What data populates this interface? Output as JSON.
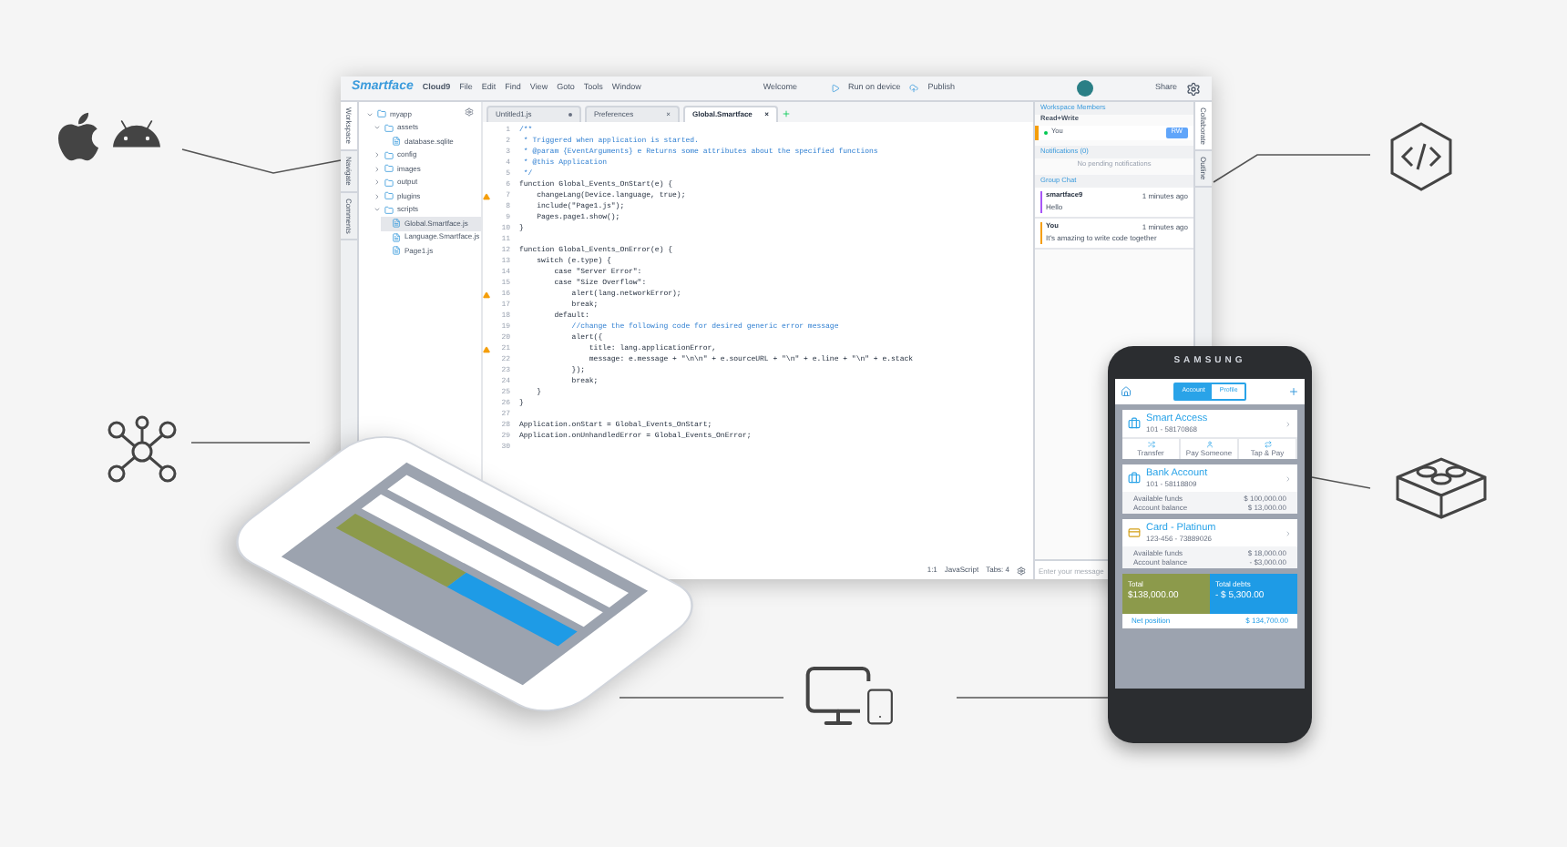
{
  "ide": {
    "menu_bar": {
      "logo": "Smartface",
      "product": "Cloud9",
      "menus": [
        "File",
        "Edit",
        "Find",
        "View",
        "Goto",
        "Tools",
        "Window"
      ],
      "welcome": "Welcome",
      "run": "Run on device",
      "publish": "Publish",
      "share": "Share"
    },
    "left_tabs": [
      {
        "label": "Workspace",
        "selected": true
      },
      {
        "label": "Navigate",
        "selected": false
      },
      {
        "label": "Comments",
        "selected": false
      }
    ],
    "file_tree": [
      {
        "name": "myapp",
        "kind": "folder",
        "expanded": true,
        "selected": false,
        "children": [
          {
            "name": "assets",
            "kind": "folder",
            "expanded": true,
            "selected": false,
            "children": [
              {
                "name": "database.sqlite",
                "kind": "file",
                "selected": false
              }
            ]
          },
          {
            "name": "config",
            "kind": "folder",
            "expanded": false,
            "selected": false
          },
          {
            "name": "images",
            "kind": "folder",
            "expanded": false,
            "selected": false
          },
          {
            "name": "output",
            "kind": "folder",
            "expanded": false,
            "selected": false
          },
          {
            "name": "plugins",
            "kind": "folder",
            "expanded": false,
            "selected": false
          },
          {
            "name": "scripts",
            "kind": "folder",
            "expanded": true,
            "selected": false,
            "children": [
              {
                "name": "Global.Smartface.js",
                "kind": "file",
                "selected": true
              },
              {
                "name": "Language.Smartface.js",
                "kind": "file",
                "selected": false
              },
              {
                "name": "Page1.js",
                "kind": "file",
                "selected": false
              }
            ]
          }
        ]
      }
    ],
    "editor_tabs": [
      {
        "label": "Untitled1.js",
        "selected": false,
        "modified": true
      },
      {
        "label": "Preferences",
        "selected": false,
        "modified": false,
        "close": "×"
      },
      {
        "label": "Global.Smartface",
        "selected": true,
        "modified": false,
        "close": "×"
      }
    ],
    "code_lines": [
      {
        "number": "1",
        "code": "/**",
        "kind": "comment",
        "warning": false
      },
      {
        "number": "2",
        "code": " * Triggered when application is started.",
        "kind": "comment",
        "warning": false
      },
      {
        "number": "3",
        "code": " * @param {EventArguments} e Returns some attributes about the specified functions",
        "kind": "comment",
        "warning": false
      },
      {
        "number": "4",
        "code": " * @this Application",
        "kind": "comment",
        "warning": false
      },
      {
        "number": "5",
        "code": " */",
        "kind": "comment",
        "warning": false
      },
      {
        "number": "6",
        "code": "function Global_Events_OnStart(e) {",
        "kind": "code",
        "warning": false
      },
      {
        "number": "7",
        "code": "    changeLang(Device.language, true);",
        "kind": "code",
        "warning": true
      },
      {
        "number": "8",
        "code": "    include(\"Page1.js\");",
        "kind": "code",
        "warning": false
      },
      {
        "number": "9",
        "code": "    Pages.page1.show();",
        "kind": "code",
        "warning": false
      },
      {
        "number": "10",
        "code": "}",
        "kind": "code",
        "warning": false
      },
      {
        "number": "11",
        "warning": false
      },
      {
        "number": "12",
        "code": "function Global_Events_OnError(e) {",
        "kind": "code",
        "warning": false
      },
      {
        "number": "13",
        "code": "    switch (e.type) {",
        "kind": "code",
        "warning": false
      },
      {
        "number": "14",
        "code": "        case \"Server Error\":",
        "kind": "code",
        "warning": false
      },
      {
        "number": "15",
        "code": "        case \"Size Overflow\":",
        "kind": "code",
        "warning": false
      },
      {
        "number": "16",
        "code": "            alert(lang.networkError);",
        "kind": "code",
        "warning": true
      },
      {
        "number": "17",
        "code": "            break;",
        "kind": "code",
        "warning": false
      },
      {
        "number": "18",
        "code": "        default:",
        "kind": "code",
        "warning": false
      },
      {
        "number": "19",
        "code": "            //change the following code for desired generic error message",
        "kind": "comment",
        "warning": false
      },
      {
        "number": "20",
        "code": "            alert({",
        "kind": "code",
        "warning": false
      },
      {
        "number": "21",
        "code": "                title: lang.applicationError,",
        "kind": "code",
        "warning": true
      },
      {
        "number": "22",
        "code": "                message: e.message + \"\\n\\n\" + e.sourceURL + \"\\n\" + e.line + \"\\n\" + e.stack",
        "kind": "code",
        "warning": false
      },
      {
        "number": "23",
        "code": "            });",
        "kind": "code",
        "warning": false
      },
      {
        "number": "24",
        "code": "            break;",
        "kind": "code",
        "warning": false
      },
      {
        "number": "25",
        "code": "    }",
        "kind": "code",
        "warning": false
      },
      {
        "number": "26",
        "code": "}",
        "kind": "code",
        "warning": false
      },
      {
        "number": "27",
        "warning": false
      },
      {
        "number": "28",
        "code": "Application.onStart = Global_Events_OnStart;",
        "kind": "code",
        "warning": false
      },
      {
        "number": "29",
        "code": "Application.onUnhandledError = Global_Events_OnError;",
        "kind": "code",
        "warning": false
      },
      {
        "number": "30",
        "warning": false
      }
    ],
    "status_bar": {
      "position": "1:1",
      "language": "JavaScript",
      "tabs": "Tabs: 4"
    },
    "right_panel": {
      "members_title": "Workspace Members",
      "access_title": "Read+Write",
      "member": {
        "name": "You",
        "online": true,
        "badge": "RW"
      },
      "notifications_title": "Notifications (0)",
      "notifications_empty": "No pending notifications",
      "chat_title": "Group Chat",
      "messages": [
        {
          "author": "smartface9",
          "time": "1 minutes ago",
          "text": "Hello",
          "color": "#a855f7"
        },
        {
          "author": "You",
          "time": "1 minutes ago",
          "text": "It's amazing to write code together",
          "color": "#f59e0b"
        }
      ],
      "input": {
        "placeholder": "Enter your message"
      }
    },
    "right_tabs": [
      {
        "label": "Collaborate",
        "selected": true
      },
      {
        "label": "Outline",
        "selected": false
      }
    ]
  },
  "android_phone": {
    "brand": "SAMSUNG",
    "segments": [
      {
        "label": "Account",
        "selected": true
      },
      {
        "label": "Profile",
        "selected": false
      }
    ],
    "accounts": [
      {
        "title": "Smart Access",
        "number": "101 - 58170868",
        "kind": "actions",
        "actions": [
          "Transfer",
          "Pay Someone",
          "Tap & Pay"
        ]
      },
      {
        "title": "Bank Account",
        "number": "101 - 58118809",
        "kind": "balance",
        "labels": [
          "Available funds",
          "Account balance"
        ],
        "amounts": [
          "$ 100,000.00",
          "$ 13,000.00"
        ]
      },
      {
        "title": "Card - Platinum",
        "number": "123-456 - 73889026",
        "kind": "balance",
        "labels": [
          "Available funds",
          "Account balance"
        ],
        "amounts": [
          "$ 18,000.00",
          "- $3,000.00"
        ]
      }
    ],
    "total_label": "Total",
    "total": "$138,000.00",
    "debts_label": "Total debts",
    "debts": "- $ 5,300.00",
    "net_label": "Net position",
    "net": "$ 134,700.00"
  }
}
